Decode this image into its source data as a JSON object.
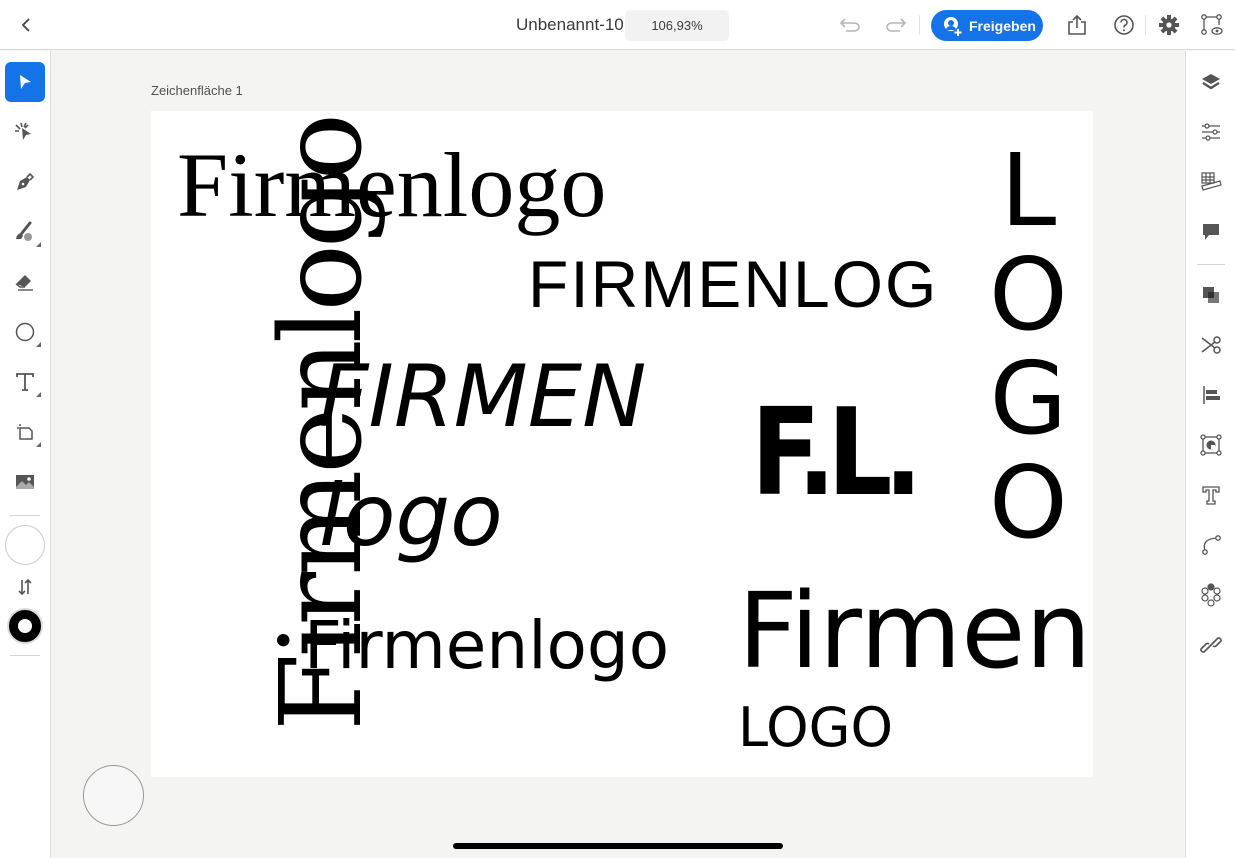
{
  "topbar": {
    "back_icon": "chevron-left-icon",
    "document_title": "Unbenannt-10",
    "zoom_level": "106,93%",
    "undo_icon": "undo-icon",
    "redo_icon": "redo-icon",
    "share_label": "Freigeben",
    "share_icon": "add-user-icon",
    "export_icon": "share-export-icon",
    "help_icon": "help-icon",
    "settings_icon": "gear-icon",
    "preview_icon": "prototype-preview-icon"
  },
  "colors": {
    "accent": "#1473e6",
    "canvas_bg": "#f4f4f3",
    "artboard_bg": "#ffffff",
    "text": "#000000"
  },
  "left_toolbar": {
    "tools": [
      {
        "name": "selection-tool",
        "icon": "arrow-pointer-icon",
        "active": true
      },
      {
        "name": "direct-selection-tool",
        "icon": "direct-select-icon"
      },
      {
        "name": "pen-tool",
        "icon": "pen-nib-icon"
      },
      {
        "name": "brush-tool",
        "icon": "brush-icon"
      },
      {
        "name": "eraser-tool",
        "icon": "eraser-icon"
      },
      {
        "name": "shape-tool",
        "icon": "circle-icon"
      },
      {
        "name": "text-tool",
        "icon": "text-t-icon"
      },
      {
        "name": "place-tool",
        "icon": "crop-place-icon"
      },
      {
        "name": "image-tool",
        "icon": "image-icon"
      }
    ],
    "fill_swatch": "#ffffff",
    "stroke_swatch": "#000000",
    "swap_icon": "swap-arrows-icon"
  },
  "right_toolbar": {
    "items": [
      {
        "name": "layers",
        "icon": "layers-icon"
      },
      {
        "name": "properties",
        "icon": "sliders-icon"
      },
      {
        "name": "grid",
        "icon": "grid-ruler-icon"
      },
      {
        "name": "comments",
        "icon": "comment-icon"
      },
      {
        "name": "arrange",
        "icon": "arrange-icon"
      },
      {
        "name": "pathfinder",
        "icon": "scissors-icon"
      },
      {
        "name": "align",
        "icon": "align-left-icon"
      },
      {
        "name": "transform",
        "icon": "transform-icon"
      },
      {
        "name": "type",
        "icon": "type-outline-icon"
      },
      {
        "name": "path",
        "icon": "bezier-path-icon"
      },
      {
        "name": "repeat",
        "icon": "radial-repeat-icon"
      },
      {
        "name": "links",
        "icon": "link-icon"
      }
    ]
  },
  "artboard": {
    "label": "Zeichenfläche 1",
    "texts": {
      "serif_title": "Firmenlogo",
      "caps_sans": "FIRMENLOG",
      "italic_firmen": "FIRMEN",
      "italic_logo": "logo",
      "rounded_sans": "Firmenlogo",
      "large_firmen": "Firmen",
      "small_logo": "LOGO",
      "initials": "F.L.",
      "rotated_script": "Firmenlogo",
      "vertical_letters": [
        "L",
        "O",
        "G",
        "O"
      ]
    }
  }
}
